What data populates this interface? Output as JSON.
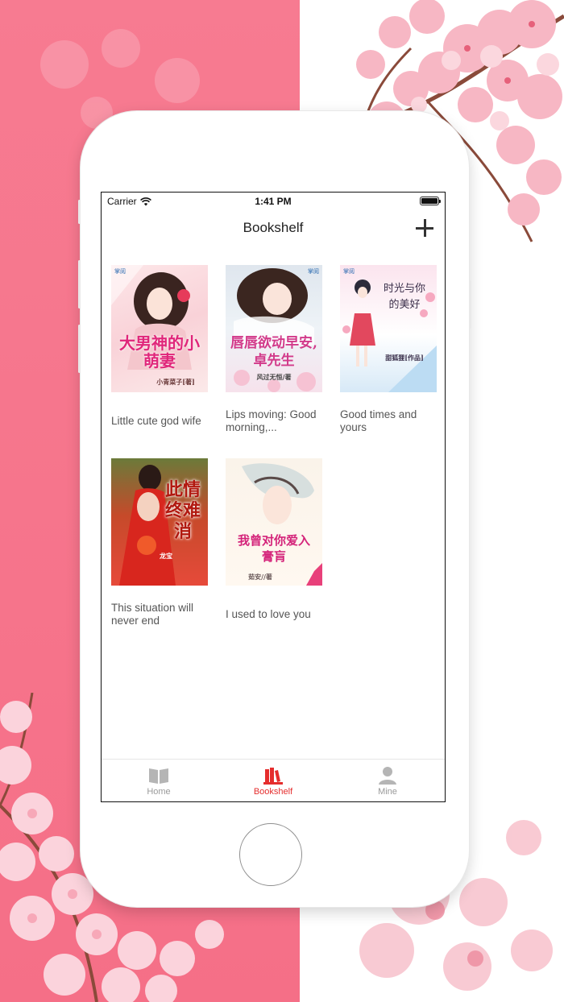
{
  "status_bar": {
    "carrier": "Carrier",
    "time": "1:41 PM",
    "wifi_icon": "wifi-icon",
    "battery_level": 1.0
  },
  "nav": {
    "title": "Bookshelf",
    "add_icon": "plus-icon"
  },
  "books": [
    {
      "title": "Little cute god wife",
      "cover_title": "大男神的小萌妻",
      "cover_author": "小青菜子[著]",
      "cover_publisher": "掌阅"
    },
    {
      "title": "Lips moving: Good morning,...",
      "cover_title": "唇唇欲动早安,卓先生",
      "cover_author": "风过无恒/著",
      "cover_publisher": "掌阅"
    },
    {
      "title": "Good times and yours",
      "cover_title": "时光与你的美好",
      "cover_author": "甜狐狸[作品]",
      "cover_publisher": "掌阅"
    },
    {
      "title": "This situation will never end",
      "cover_title": "此情终难消",
      "cover_author": "龙宝",
      "cover_publisher": ""
    },
    {
      "title": "I used to love you",
      "cover_title": "我曾对你爱入膏肓",
      "cover_author": "茹安//著",
      "cover_publisher": ""
    }
  ],
  "tabs": [
    {
      "label": "Home",
      "icon": "book-open-icon",
      "active": false
    },
    {
      "label": "Bookshelf",
      "icon": "bookshelf-icon",
      "active": true
    },
    {
      "label": "Mine",
      "icon": "person-icon",
      "active": false
    }
  ],
  "colors": {
    "accent": "#e52d2d",
    "background_pink": "#f77b91",
    "inactive_tab": "#9a9a9a"
  }
}
